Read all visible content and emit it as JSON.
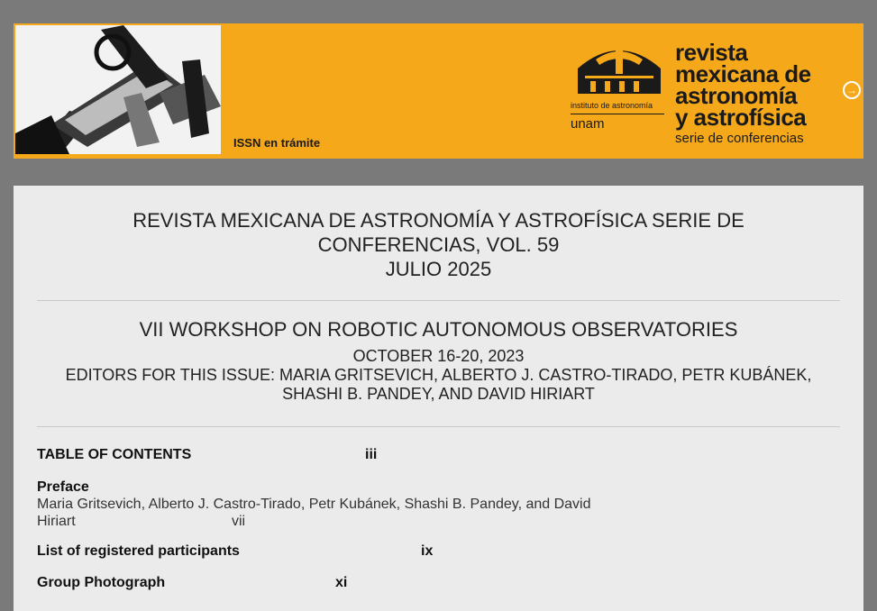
{
  "banner": {
    "issn": "ISSN en trámite",
    "logo_institute": "instituto de astronomía",
    "logo_unam": "unam",
    "logo_title_lines": [
      "revista",
      "mexicana de",
      "astronomía",
      "y astrofísica"
    ],
    "logo_subtitle": "serie de conferencias",
    "photo_icon": "telescope-photo",
    "next_icon": "arrow-right-circle-icon",
    "accent_color": "#f5a81a"
  },
  "header": {
    "title_line1": "REVISTA MEXICANA DE ASTRONOMÍA Y ASTROFÍSICA SERIE DE CONFERENCIAS, VOL. 59",
    "title_line2": "JULIO 2025"
  },
  "issue": {
    "workshop": "VII WORKSHOP ON ROBOTIC AUTONOMOUS OBSERVATORIES",
    "dates": "OCTOBER 16-20, 2023",
    "editors": "EDITORS FOR THIS ISSUE: MARIA GRITSEVICH, ALBERTO J. CASTRO-TIRADO, PETR KUBÁNEK, SHASHI B. PANDEY, AND DAVID HIRIART"
  },
  "toc": {
    "heading": "TABLE OF CONTENTS",
    "heading_page": "iii",
    "items": [
      {
        "title": "Preface",
        "authors": "Maria Gritsevich, Alberto J. Castro-Tirado, Petr Kubánek, Shashi B. Pandey, and David",
        "authors_cont": "Hiriart",
        "page": "vii"
      },
      {
        "title": "List of registered participants",
        "page": "ix"
      },
      {
        "title": "Group Photograph",
        "page": "xi"
      }
    ]
  }
}
